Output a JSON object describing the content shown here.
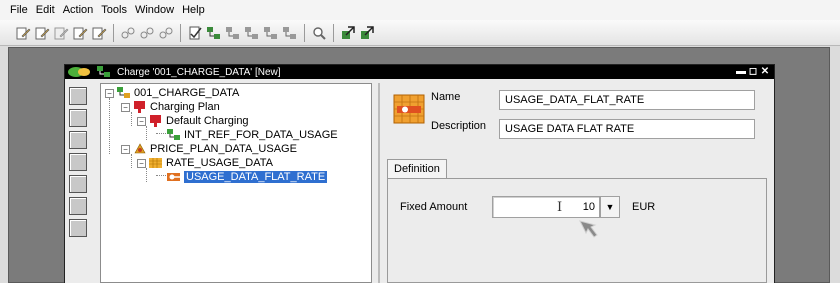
{
  "menubar": {
    "items": [
      "File",
      "Edit",
      "Action",
      "Tools",
      "Window",
      "Help"
    ]
  },
  "toolbar": {
    "buttons": [
      "edit-icon",
      "edit-icon",
      "edit-icon",
      "edit-icon",
      "edit-icon",
      "link-icon",
      "link-icon",
      "link-icon",
      "validate-icon",
      "hierarchy-icon",
      "hierarchy-icon",
      "hierarchy-icon",
      "hierarchy-icon",
      "hierarchy-icon",
      "search-icon",
      "deploy-icon",
      "deploy-icon"
    ]
  },
  "window": {
    "title": "Charge '001_CHARGE_DATA' [New]",
    "controls": {
      "minimize": "▬",
      "restore": "◻",
      "close": "✕"
    }
  },
  "tree": {
    "root": "001_CHARGE_DATA",
    "charging_plan": "Charging Plan",
    "default_charging": "Default Charging",
    "int_ref": "INT_REF_FOR_DATA_USAGE",
    "price_plan": "PRICE_PLAN_DATA_USAGE",
    "rate_usage": "RATE_USAGE_DATA",
    "flat_rate": "USAGE_DATA_FLAT_RATE"
  },
  "detail": {
    "name_label": "Name",
    "name_value": "USAGE_DATA_FLAT_RATE",
    "description_label": "Description",
    "description_value": "USAGE DATA FLAT RATE",
    "tab_definition": "Definition",
    "fixed_amount_label": "Fixed Amount",
    "fixed_amount_value": "10",
    "currency": "EUR"
  },
  "colors": {
    "selection": "#2f6fd0",
    "workspace": "#7b7b7b",
    "title_bar": "#000000"
  }
}
